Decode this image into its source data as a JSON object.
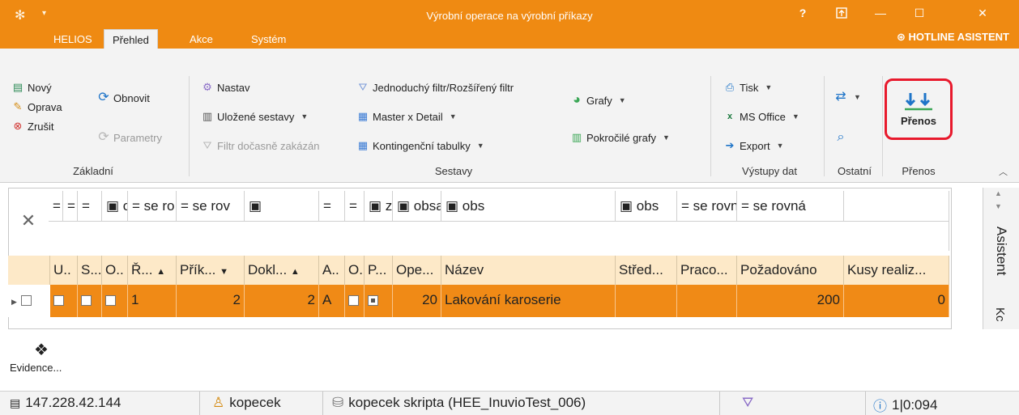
{
  "window": {
    "title": "Výrobní operace na výrobní příkazy",
    "help": "?",
    "pin_icon": "pin-icon",
    "minimize": "—",
    "maximize": "☐",
    "close": "✕"
  },
  "tabs": [
    "HELIOS",
    "Přehled",
    "Akce",
    "Systém"
  ],
  "hotline": "HOTLINE ASISTENT",
  "ribbon": {
    "zakladni": {
      "novy": "Nový",
      "oprava": "Oprava",
      "zrusit": "Zrušit",
      "obnovit": "Obnovit",
      "parametry": "Parametry",
      "label": "Základní"
    },
    "sestavy": {
      "nastav": "Nastav",
      "ulozene": "Uložené sestavy",
      "filtr_zakazan": "Filtr dočasně zakázán",
      "jednoduchy_filtr": "Jednoduchý filtr/Rozšířený filtr",
      "master_detail": "Master x Detail",
      "kontingencni": "Kontingenční tabulky",
      "grafy": "Grafy",
      "pokrocile_grafy": "Pokročilé grafy",
      "label": "Sestavy"
    },
    "vystupy": {
      "tisk": "Tisk",
      "ms_office": "MS Office",
      "export": "Export",
      "label": "Výstupy dat"
    },
    "ostatni": {
      "label": "Ostatní"
    },
    "prenos": {
      "button": "Přenos",
      "label": "Přenos"
    }
  },
  "grid": {
    "filter_ops": [
      "=",
      "=",
      "=",
      "▣ ob",
      "= se ro",
      "= se rov",
      "▣",
      "=",
      "=",
      "▣ za",
      "▣ obsahuje",
      "▣ obs",
      "▣ obs",
      "= se rovná",
      "= se rovná"
    ],
    "headers": [
      "U..",
      "S...",
      "O..",
      "Ř...",
      "Přík...",
      "Dokl...",
      "A..",
      "O..",
      "P...",
      "Ope...",
      "Název",
      "Střed...",
      "Praco...",
      "Požadováno",
      "Kusy realiz..."
    ],
    "row": {
      "r": "1",
      "prikaz": "2",
      "doklad": "2",
      "a": "A",
      "operace": "20",
      "nazev": "Lakování karoserie",
      "pozadovano": "200",
      "kusy": "0"
    }
  },
  "sidebar": {
    "asistent": "Asistent",
    "k": "Kc"
  },
  "evidence": "Evidence...",
  "status": {
    "ip": "147.228.42.144",
    "user": "kopecek",
    "db": "kopecek skripta (HEE_InuvioTest_006)",
    "info": "1|0:094"
  },
  "colors": {
    "accent": "#ef8a12",
    "highlight": "#e8192c",
    "row": "#f08a16"
  }
}
